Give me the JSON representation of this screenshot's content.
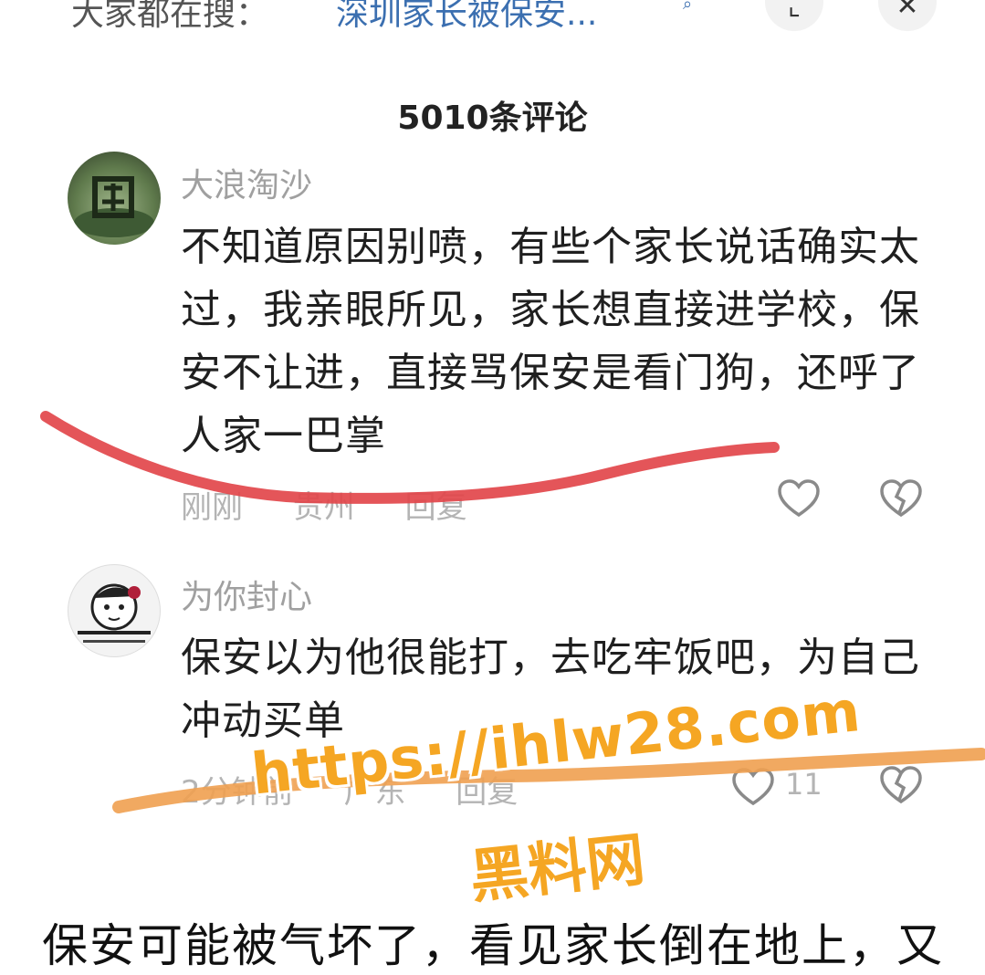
{
  "topbar": {
    "search_prefix": "大家都在搜：",
    "search_link": "深圳家长被保安...",
    "expand_icon": "expand-icon",
    "close_icon": "close-icon"
  },
  "comments_header": {
    "count_label": "5010条评论"
  },
  "comments": [
    {
      "username": "大浪淘沙",
      "text": "不知道原因别喷，有些个家长说话确实太过，我亲眼所见，家长想直接进学校，保安不让进，直接骂保安是看门狗，还呼了人家一巴掌",
      "time": "刚刚",
      "location": "贵州",
      "reply_label": "回复",
      "like_count": ""
    },
    {
      "username": "为你封心",
      "text": "保安以为他很能打，去吃牢饭吧，为自己冲动买单",
      "time": "2分钟前",
      "location": "广东",
      "reply_label": "回复",
      "like_count": "11"
    }
  ],
  "watermark": {
    "url": "https://ihlw28.com",
    "name": "黑料网"
  },
  "bottom_text": "保安可能被气坏了，看见家长倒在地上，又",
  "colors": {
    "accent_link": "#3b6fb0",
    "red_scribble": "#e2474b",
    "orange_scribble": "#f0a050",
    "watermark": "#f5a623"
  }
}
